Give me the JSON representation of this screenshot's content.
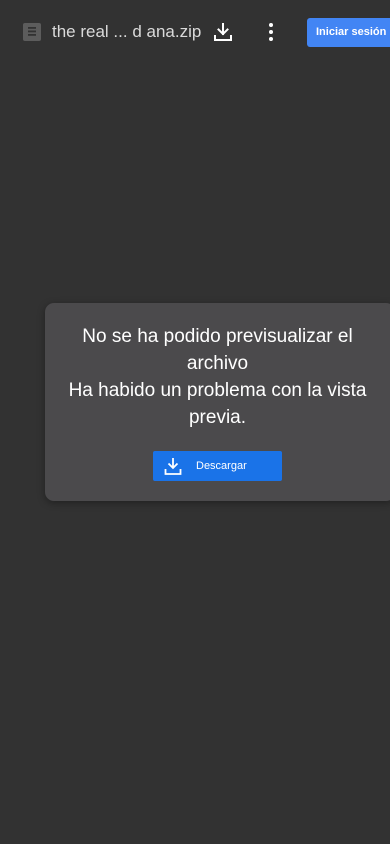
{
  "header": {
    "file_icon": "document-icon",
    "file_name": "the real ... d ana.zip",
    "download_icon": "download-icon",
    "more_icon": "more-vert-icon",
    "signin_label": "Iniciar sesión",
    "signin_color": "#4285f4"
  },
  "preview": {
    "title": "No se ha podido previsualizar el archivo",
    "subtitle": "Ha habido un problema con la vista previa.",
    "download_label": "Descargar",
    "download_color": "#1a73e8"
  },
  "colors": {
    "background": "#323232",
    "card": "#4b4a4c"
  }
}
